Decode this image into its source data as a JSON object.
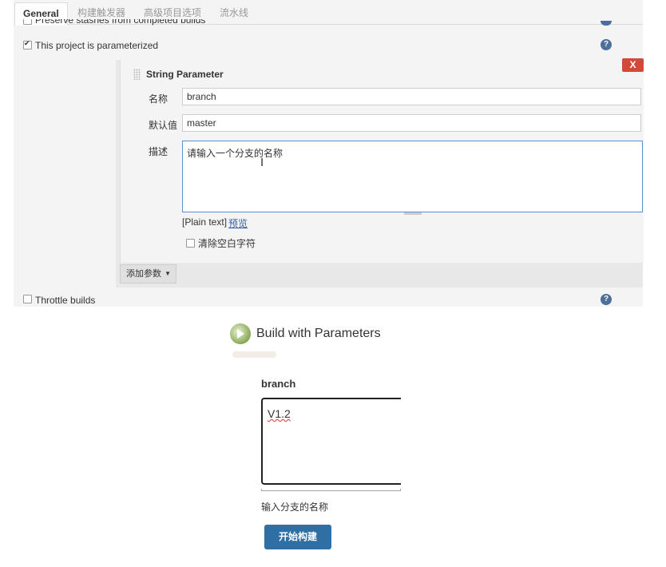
{
  "tabs": [
    "General",
    "构建触发器",
    "高级项目选项",
    "流水线"
  ],
  "options": {
    "preserve_stashes": "Preserve stashes from completed builds",
    "parameterized": "This project is parameterized",
    "throttle": "Throttle builds"
  },
  "help_icon_glyph": "?",
  "param": {
    "title": "String Parameter",
    "delete_label": "X",
    "name_label": "名称",
    "name_value": "branch",
    "default_label": "默认值",
    "default_value": "master",
    "desc_label": "描述",
    "desc_value": "请输入一个分支的名称",
    "plain_text": "[Plain text]",
    "preview": "预览",
    "trim_label": "清除空白字符"
  },
  "add_param_label": "添加参数",
  "build": {
    "title": "Build with Parameters",
    "param_name": "branch",
    "param_value": "V1.2",
    "param_description": "输入分支的名称",
    "button_label": "开始构建"
  },
  "colors": {
    "delete_red": "#d24939",
    "build_blue": "#2f6fa3",
    "help_blue": "#4c6f9c"
  }
}
